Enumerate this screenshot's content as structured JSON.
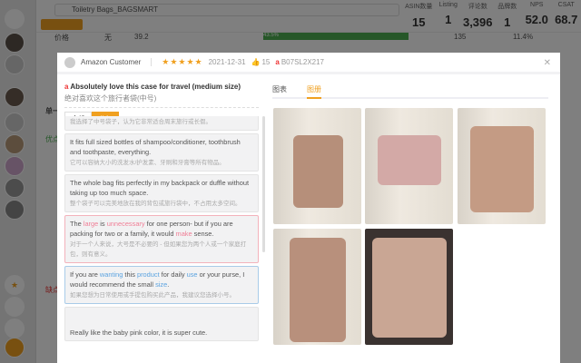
{
  "app": {
    "product_title": "Toiletry Bags_BAGSMART",
    "metrics": [
      {
        "label": "ASIN数量",
        "value": "15"
      },
      {
        "label": "Listing",
        "value": "1"
      },
      {
        "label": "评论数",
        "value": "3,396"
      },
      {
        "label": "品牌数",
        "value": "1"
      },
      {
        "label": "NPS",
        "value": "52.0"
      },
      {
        "label": "CSAT",
        "value": "68.7"
      }
    ],
    "row": {
      "label": "价格",
      "col2": "无",
      "col3": "39.2",
      "pct": "43.5%",
      "count": "135",
      "share": "11.4%"
    },
    "section_title": "单一",
    "good_label": "优点",
    "bad_label": "缺点"
  },
  "review": {
    "author": "Amazon Customer",
    "stars": "★★★★★",
    "date": "2021-12-31",
    "likes": "15",
    "asin": "B07SL2X217",
    "title": "Absolutely love this case for travel (medium size)",
    "title_zh": "绝对喜欢这个旅行者袋(中号)",
    "filters": [
      "全部",
      "分句"
    ],
    "sentences": [
      {
        "en": "",
        "zh": "我选择了中号袋子，认为它非常适合周末旅行或长假。",
        "style": "plain"
      },
      {
        "en": "It fits full sized bottles of shampoo/conditioner, toothbrush and toothpaste, everything.",
        "zh": "它可以容纳大小的洗发水/护发素、牙刷和牙膏等所有物品。",
        "style": "plain"
      },
      {
        "en": "The whole bag fits perfectly in my backpack or duffle without taking up too much space.",
        "zh": "整个袋子可以完美地放在我的背包或旅行袋中，不占用太多空间。",
        "style": "plain"
      },
      {
        "parts": [
          [
            "The ",
            ""
          ],
          [
            "large",
            "h"
          ],
          [
            " is ",
            ""
          ],
          [
            "unnecessary",
            "h"
          ],
          [
            " for one person- but if you are packing for two or a family, it would ",
            ""
          ],
          [
            "make",
            "h"
          ],
          [
            " sense.",
            ""
          ]
        ],
        "zh": "对于一个人来说，大号是不必要的 - 但如果您为两个人或一个家庭打包，则有意义。",
        "style": "red"
      },
      {
        "parts": [
          [
            "If you are ",
            ""
          ],
          [
            "wanting",
            "h"
          ],
          [
            " this ",
            ""
          ],
          [
            "product",
            "h"
          ],
          [
            " for daily ",
            ""
          ],
          [
            "use",
            "h"
          ],
          [
            " or your purse, I would recommend the small ",
            ""
          ],
          [
            "size",
            "h"
          ],
          [
            ".",
            ""
          ]
        ],
        "zh": "如果您想为日常使用或手提包购买此产品，我建议您选择小号。",
        "style": "blue"
      },
      {
        "en": "Really like the baby pink color, it is super cute.",
        "zh": "",
        "style": "plain"
      }
    ]
  },
  "tabs": [
    "图表",
    "图册"
  ],
  "colors": {
    "accent": "#f0a020",
    "negative": "#f07e96",
    "positive": "#5ba3e0"
  }
}
